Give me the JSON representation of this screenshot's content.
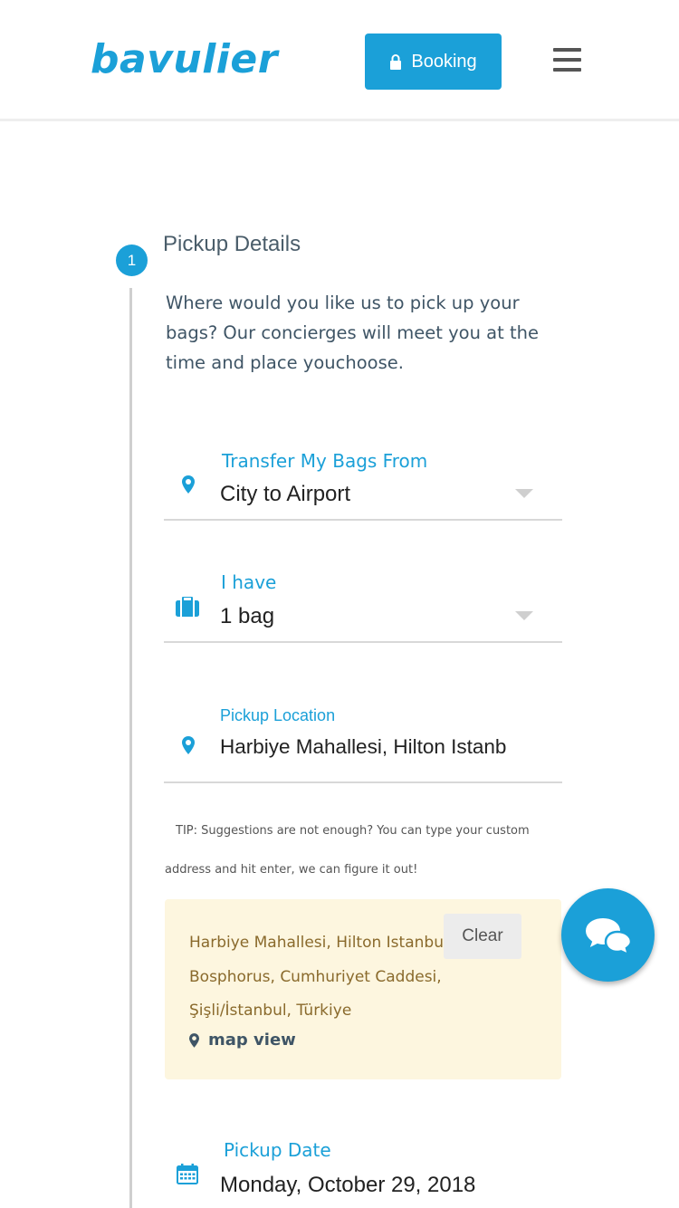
{
  "header": {
    "logo": "bavulier",
    "booking_label": "Booking"
  },
  "step": {
    "number": "1",
    "title": "Pickup Details",
    "intro": "Where would you like us to pick up your bags? Our concierges will meet you at the time and place youchoose."
  },
  "fields": {
    "transfer": {
      "label": "Transfer My Bags From",
      "value": "City to Airport"
    },
    "bags": {
      "label": "I have",
      "value": "1 bag"
    },
    "location": {
      "label": "Pickup Location",
      "value": "Harbiye Mahallesi, Hilton Istanb"
    },
    "date": {
      "label": "Pickup Date",
      "value": "Monday, October 29, 2018"
    }
  },
  "tip": "TIP: Suggestions are not enough? You can type your custom address and hit enter, we can figure it out!",
  "address_box": {
    "address": "Harbiye Mahallesi, Hilton Istanbul Bosphorus, Cumhuriyet Caddesi, Şişli/İstanbul, Türkiye",
    "clear_label": "Clear",
    "map_label": "map view"
  },
  "colors": {
    "accent": "#1ba0d8",
    "address_bg": "#fdf6df",
    "address_text": "#8a6a2c"
  }
}
